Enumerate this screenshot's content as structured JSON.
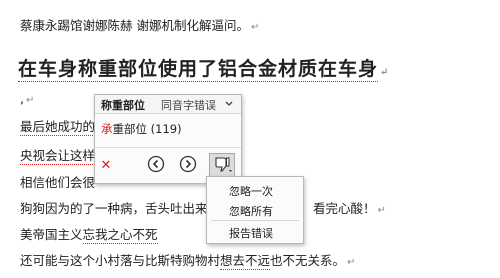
{
  "document": {
    "line1": {
      "text": "蔡康永踢馆谢娜陈赫 谢娜机制化解逼问。"
    },
    "heading": "在车身称重部位使用了铝合金材质在车身",
    "line2_prefix": ",",
    "line3_prefix": "最后她成功的",
    "line4_prefix": "央视会让这样",
    "line5_prefix": "相信他们会很",
    "line6_prefix": "狗狗因为的了一种病，舌头吐出来",
    "line6_suffix": "看完心酸！",
    "line7_a": "美帝国主义",
    "line7_b": "忘我之心不死",
    "line8_a": "还可能与这个小村落与比斯特购物村",
    "line8_b": "想去不远",
    "line8_c": "也不无关系。",
    "para_mark": "↵"
  },
  "popup": {
    "title": "称重部位",
    "error_type": "同音字错误",
    "suggestion_highlight": "承",
    "suggestion_rest": "重部位 (119)",
    "close_symbol": "✕"
  },
  "context_menu": {
    "items": [
      "忽略一次",
      "忽略所有",
      "报告错误"
    ]
  },
  "colors": {
    "error_underline": "#e02020",
    "accent_red": "#e02020"
  }
}
